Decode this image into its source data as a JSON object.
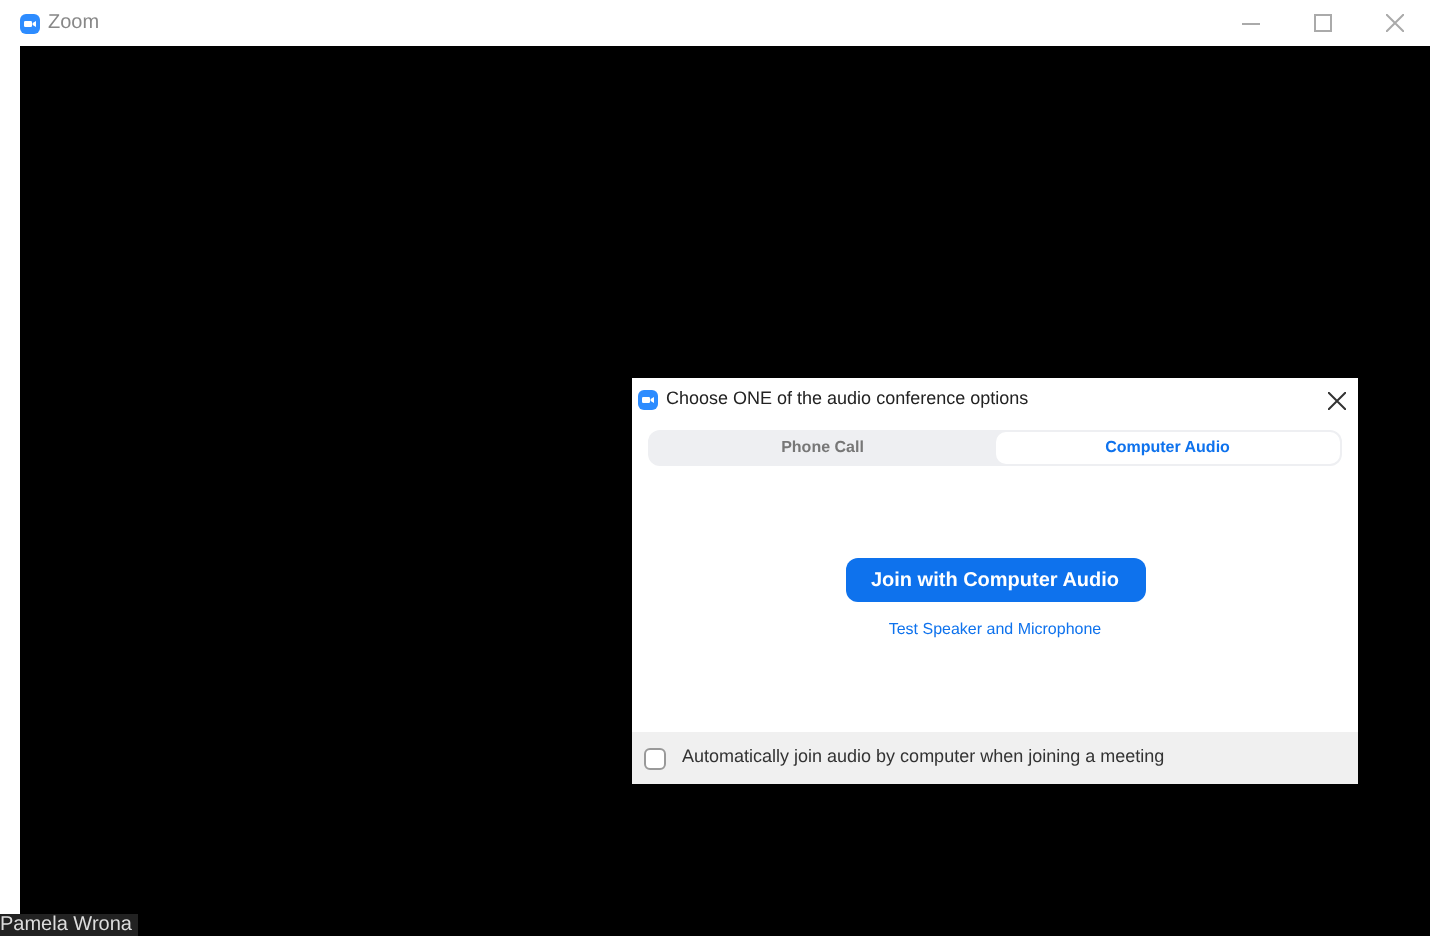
{
  "window": {
    "title": "Zoom"
  },
  "participant": {
    "name": "Pamela Wrona"
  },
  "dialog": {
    "title": "Choose ONE of the audio conference options",
    "tabs": [
      {
        "label": "Phone Call",
        "selected": false
      },
      {
        "label": "Computer Audio",
        "selected": true
      }
    ],
    "join_button": "Join with Computer Audio",
    "test_link": "Test Speaker and Microphone",
    "auto_join": {
      "label": "Automatically join audio by computer when joining a meeting",
      "checked": false
    }
  }
}
